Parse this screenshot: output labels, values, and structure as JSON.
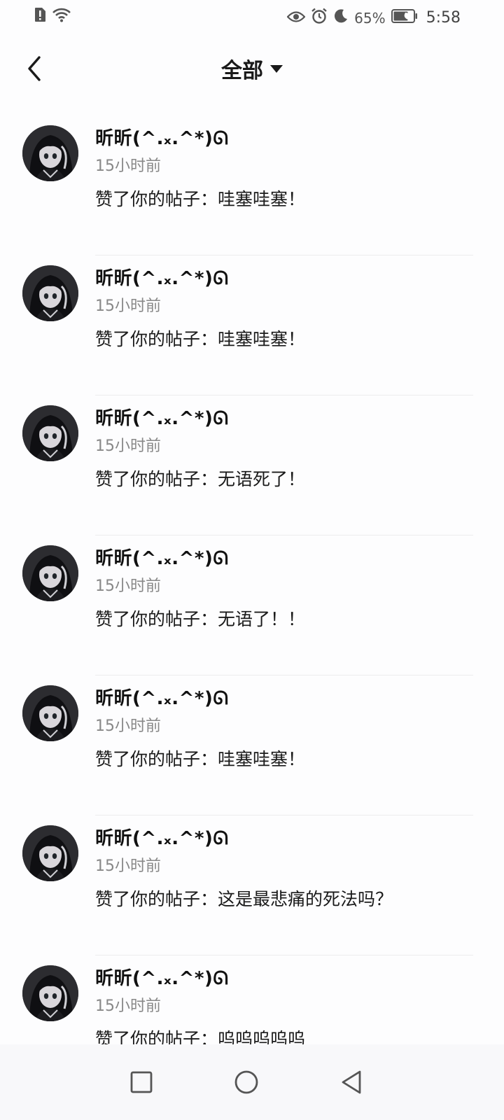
{
  "status_bar": {
    "battery_percent": "65%",
    "time": "5:58",
    "left_icons": [
      "alert-sim-icon",
      "wifi-icon"
    ],
    "right_icons": [
      "eye-icon",
      "alarm-icon",
      "moon-icon",
      "battery-icon"
    ]
  },
  "header": {
    "title": "全部",
    "back_icon": "chevron-left-icon",
    "dropdown_icon": "caret-down-icon"
  },
  "notifications": [
    {
      "name": "昕昕(^.ₓ.^*)ᘏ",
      "time": "15小时前",
      "content": "赞了你的帖子：哇塞哇塞！"
    },
    {
      "name": "昕昕(^.ₓ.^*)ᘏ",
      "time": "15小时前",
      "content": "赞了你的帖子：哇塞哇塞！"
    },
    {
      "name": "昕昕(^.ₓ.^*)ᘏ",
      "time": "15小时前",
      "content": "赞了你的帖子：无语死了！"
    },
    {
      "name": "昕昕(^.ₓ.^*)ᘏ",
      "time": "15小时前",
      "content": "赞了你的帖子：无语了！！"
    },
    {
      "name": "昕昕(^.ₓ.^*)ᘏ",
      "time": "15小时前",
      "content": "赞了你的帖子：哇塞哇塞！"
    },
    {
      "name": "昕昕(^.ₓ.^*)ᘏ",
      "time": "15小时前",
      "content": "赞了你的帖子：这是最悲痛的死法吗？"
    },
    {
      "name": "昕昕(^.ₓ.^*)ᘏ",
      "time": "15小时前",
      "content": "赞了你的帖子：呜呜呜呜呜"
    }
  ],
  "nav_bar": {
    "icons": [
      "recents-square-icon",
      "home-circle-icon",
      "back-triangle-icon"
    ]
  },
  "colors": {
    "background": "#fdfdfe",
    "text_primary": "#1a1a1a",
    "text_secondary": "#888888",
    "divider": "#ececee"
  }
}
